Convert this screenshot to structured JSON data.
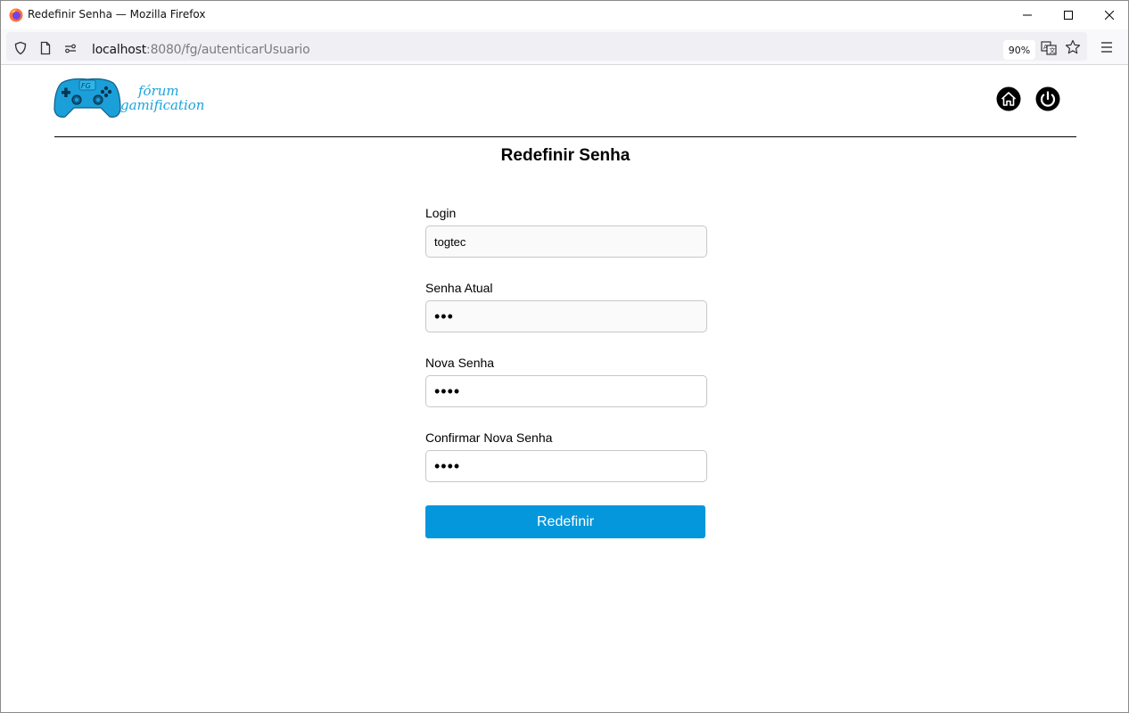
{
  "window": {
    "title": "Redefinir Senha — Mozilla Firefox"
  },
  "navbar": {
    "url_host": "localhost",
    "url_rest": ":8080/fg/autenticarUsuario",
    "zoom": "90%"
  },
  "header": {
    "logo_line1": "fórum",
    "logo_line2": "gamification",
    "logo_badge": "FG",
    "icons": [
      "home-icon",
      "power-icon"
    ]
  },
  "main": {
    "title": "Redefinir Senha",
    "fields": [
      {
        "label": "Login",
        "value": "togtec"
      },
      {
        "label": "Senha Atual",
        "value": "•••"
      },
      {
        "label": "Nova Senha",
        "value": "••••"
      },
      {
        "label": "Confirmar Nova Senha",
        "value": "••••"
      }
    ],
    "submit_label": "Redefinir"
  },
  "colors": {
    "accent": "#0497db",
    "logo_blue": "#1aa3dc"
  }
}
